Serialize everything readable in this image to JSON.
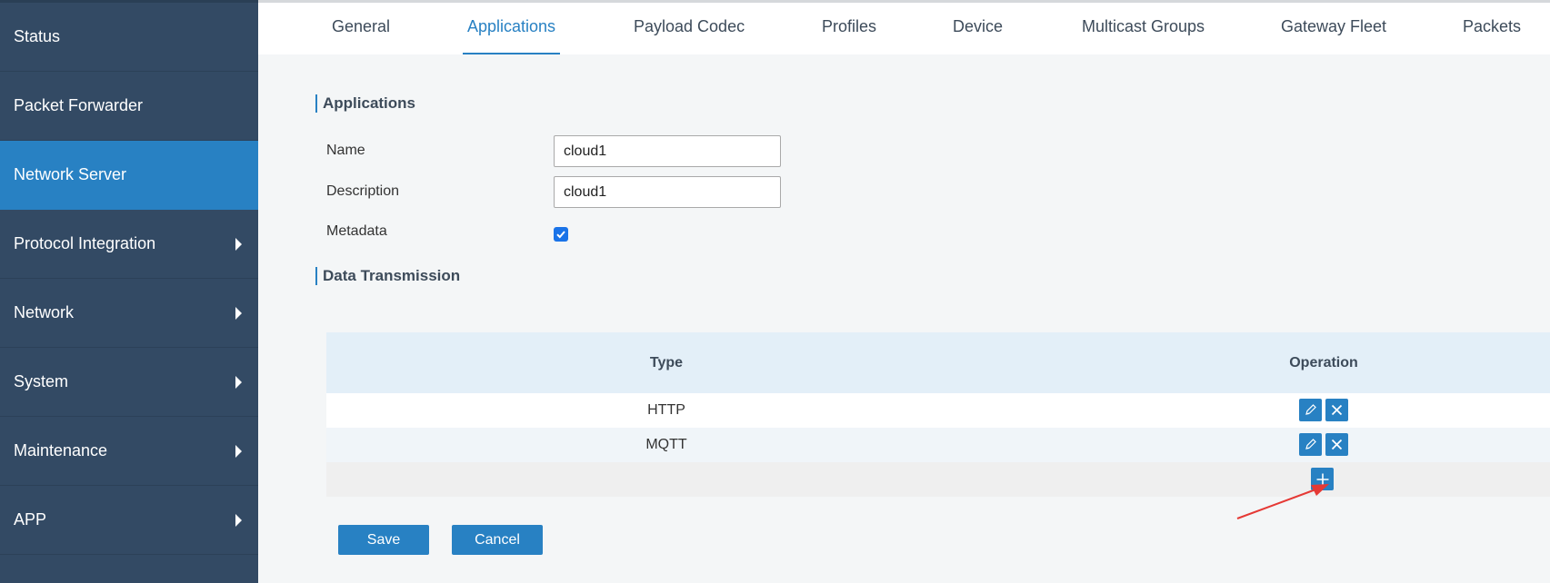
{
  "sidebar": {
    "items": [
      {
        "label": "Status",
        "has_submenu": false,
        "active": false
      },
      {
        "label": "Packet Forwarder",
        "has_submenu": false,
        "active": false
      },
      {
        "label": "Network Server",
        "has_submenu": false,
        "active": true
      },
      {
        "label": "Protocol Integration",
        "has_submenu": true,
        "active": false
      },
      {
        "label": "Network",
        "has_submenu": true,
        "active": false
      },
      {
        "label": "System",
        "has_submenu": true,
        "active": false
      },
      {
        "label": "Maintenance",
        "has_submenu": true,
        "active": false
      },
      {
        "label": "APP",
        "has_submenu": true,
        "active": false
      }
    ]
  },
  "tabs": [
    {
      "label": "General",
      "active": false
    },
    {
      "label": "Applications",
      "active": true
    },
    {
      "label": "Payload Codec",
      "active": false
    },
    {
      "label": "Profiles",
      "active": false
    },
    {
      "label": "Device",
      "active": false
    },
    {
      "label": "Multicast Groups",
      "active": false
    },
    {
      "label": "Gateway Fleet",
      "active": false
    },
    {
      "label": "Packets",
      "active": false
    }
  ],
  "form": {
    "section_title": "Applications",
    "name_label": "Name",
    "name_value": "cloud1",
    "description_label": "Description",
    "description_value": "cloud1",
    "metadata_label": "Metadata",
    "metadata_checked": true
  },
  "transmission": {
    "section_title": "Data Transmission",
    "columns": {
      "type": "Type",
      "operation": "Operation"
    },
    "rows": [
      {
        "type": "HTTP"
      },
      {
        "type": "MQTT"
      }
    ]
  },
  "actions": {
    "save_label": "Save",
    "cancel_label": "Cancel"
  },
  "colors": {
    "sidebar_bg": "#334a64",
    "accent": "#2881c3",
    "annotation_arrow": "#e53935"
  }
}
